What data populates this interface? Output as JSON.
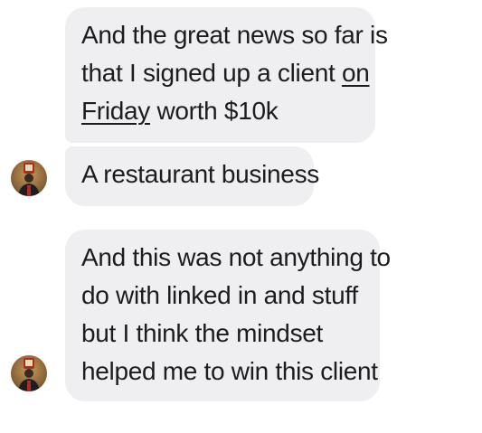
{
  "messages": [
    {
      "lines": [
        {
          "text": "And the great news so far is"
        },
        {
          "prefix": "that I signed up a client ",
          "underlined": "on"
        },
        {
          "underlined": "Friday",
          "suffix": " worth $10k"
        }
      ]
    },
    {
      "lines": [
        {
          "text": "A restaurant business"
        }
      ]
    },
    {
      "lines": [
        {
          "text": "And this was not anything to"
        },
        {
          "text": "do with linked in and stuff"
        },
        {
          "text": "but I think the mindset"
        },
        {
          "text": "helped me to win this client"
        }
      ]
    }
  ],
  "colors": {
    "bubble_bg": "#efeff1",
    "text": "#1c1c1e"
  },
  "avatar": {
    "icon": "sender-avatar-photo"
  }
}
